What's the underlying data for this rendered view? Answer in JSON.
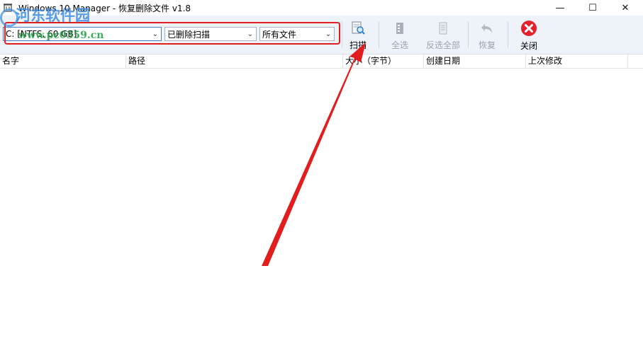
{
  "window": {
    "title": "Windows 10 Manager - 恢复删除文件 v1.8",
    "minimize_glyph": "—",
    "maximize_glyph": "☐",
    "close_glyph": "✕"
  },
  "watermark": {
    "brand": "河东软件园",
    "url": "www.pc0359.cn"
  },
  "filters": {
    "drive": "C: [NTFS, 60 GB]",
    "mode": "已删除扫描",
    "file_type": "所有文件"
  },
  "toolbar": {
    "scan": "扫描",
    "select_all": "全选",
    "invert_selection": "反选全部",
    "restore": "恢复",
    "close": "关闭"
  },
  "table": {
    "columns": [
      "名字",
      "路径",
      "大小（字节）",
      "创建日期",
      "上次修改"
    ]
  },
  "colors": {
    "highlight_box": "#e21d1d",
    "arrow": "#e21d1d",
    "toolbar_bg": "#eef3fa",
    "close_icon": "#e0242e"
  },
  "icons": [
    "app-icon",
    "scan-icon",
    "select-all-icon",
    "invert-selection-icon",
    "restore-icon",
    "close-circle-icon",
    "chevron-down-icon"
  ]
}
